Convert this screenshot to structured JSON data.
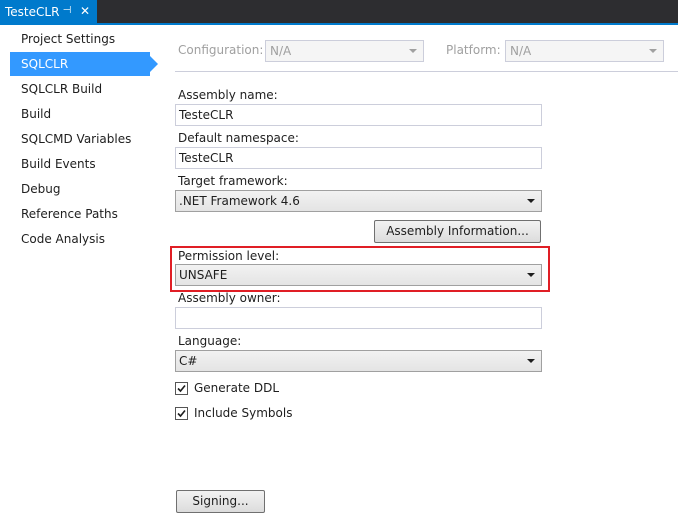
{
  "tab": {
    "title": "TesteCLR",
    "pin_glyph": "⊣",
    "close_glyph": "✕"
  },
  "nav": {
    "items": [
      {
        "label": "Project Settings",
        "selected": false
      },
      {
        "label": "SQLCLR",
        "selected": true
      },
      {
        "label": "SQLCLR Build",
        "selected": false
      },
      {
        "label": "Build",
        "selected": false
      },
      {
        "label": "SQLCMD Variables",
        "selected": false
      },
      {
        "label": "Build Events",
        "selected": false
      },
      {
        "label": "Debug",
        "selected": false
      },
      {
        "label": "Reference Paths",
        "selected": false
      },
      {
        "label": "Code Analysis",
        "selected": false
      }
    ]
  },
  "config_bar": {
    "configuration_label": "Configuration:",
    "configuration_value": "N/A",
    "platform_label": "Platform:",
    "platform_value": "N/A"
  },
  "form": {
    "assembly_name_label": "Assembly name:",
    "assembly_name_value": "TesteCLR",
    "default_namespace_label": "Default namespace:",
    "default_namespace_value": "TesteCLR",
    "target_framework_label": "Target framework:",
    "target_framework_value": ".NET Framework 4.6",
    "assembly_info_button": "Assembly Information...",
    "permission_level_label": "Permission level:",
    "permission_level_value": "UNSAFE",
    "assembly_owner_label": "Assembly owner:",
    "assembly_owner_value": "",
    "language_label": "Language:",
    "language_value": "C#",
    "generate_ddl_label": "Generate DDL",
    "generate_ddl_checked": true,
    "include_symbols_label": "Include Symbols",
    "include_symbols_checked": true,
    "signing_button": "Signing..."
  },
  "colors": {
    "accent": "#007acc",
    "nav_selected": "#3399ff",
    "highlight_border": "#e01e25"
  }
}
